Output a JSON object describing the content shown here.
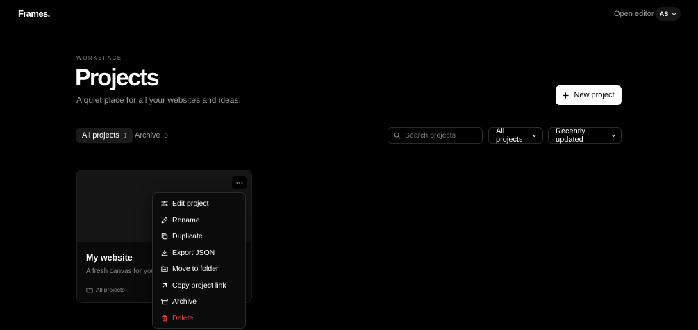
{
  "header": {
    "brand": "Frames.",
    "open_editor": "Open editor",
    "avatar_initials": "AS"
  },
  "page": {
    "eyebrow": "WORKSPACE",
    "title": "Projects",
    "subtitle": "A quiet place for all your websites and ideas.",
    "new_project_label": "New project"
  },
  "tabs": [
    {
      "label": "All projects",
      "count": "1"
    },
    {
      "label": "Archive",
      "count": "0"
    }
  ],
  "filters": {
    "search_placeholder": "Search projects",
    "scope": "All projects",
    "sort": "Recently updated"
  },
  "project": {
    "title": "My website",
    "description": "A fresh canvas for your",
    "folder": "All projects"
  },
  "menu": {
    "items": [
      {
        "label": "Edit project",
        "icon": "sliders-icon"
      },
      {
        "label": "Rename",
        "icon": "pencil-icon"
      },
      {
        "label": "Duplicate",
        "icon": "copy-icon"
      },
      {
        "label": "Export JSON",
        "icon": "download-icon"
      },
      {
        "label": "Move to folder",
        "icon": "folder-move-icon"
      },
      {
        "label": "Copy project link",
        "icon": "arrow-up-right-icon"
      },
      {
        "label": "Archive",
        "icon": "archive-icon"
      },
      {
        "label": "Delete",
        "icon": "trash-icon"
      }
    ]
  },
  "colors": {
    "background": "#000000",
    "primary_button": "#ffffff",
    "danger": "#ef4444",
    "muted_text": "#8a8a8a"
  }
}
